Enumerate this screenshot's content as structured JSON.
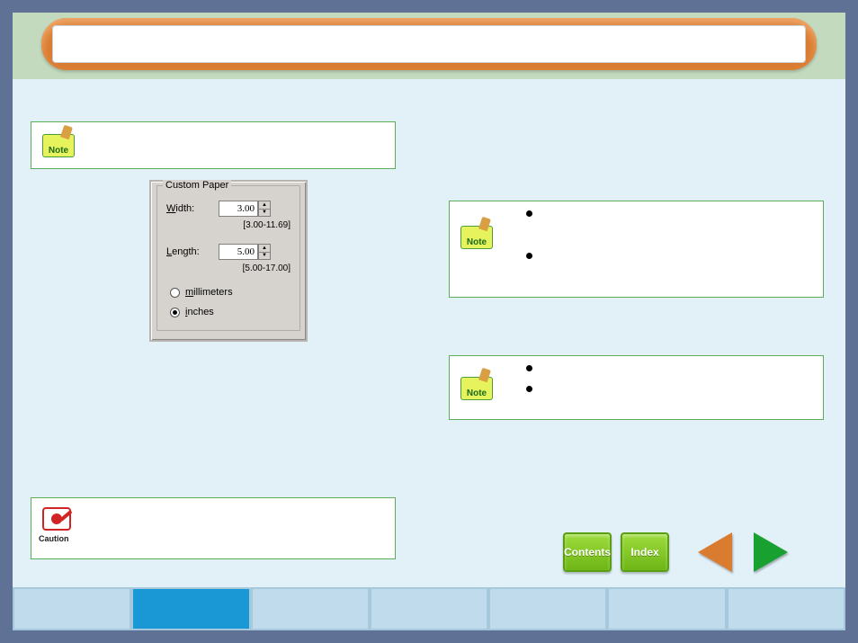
{
  "header": {
    "title": ""
  },
  "notes": {
    "badge_label": "Note",
    "box1": {},
    "box2": {
      "bullets": [
        "",
        ""
      ]
    },
    "box3": {
      "bullets": [
        "",
        ""
      ]
    }
  },
  "caution": {
    "label": "Caution"
  },
  "custom_paper": {
    "legend": "Custom Paper",
    "width_label": "Width:",
    "width_value": "3.00",
    "width_range": "[3.00-11.69]",
    "length_label": "Length:",
    "length_value": "5.00",
    "length_range": "[5.00-17.00]",
    "unit_mm_label": "millimeters",
    "unit_in_label": "inches",
    "selected_unit": "inches"
  },
  "nav": {
    "contents": "Contents",
    "index": "Index"
  },
  "bottom_tabs": {
    "count": 7,
    "active_index": 1
  }
}
